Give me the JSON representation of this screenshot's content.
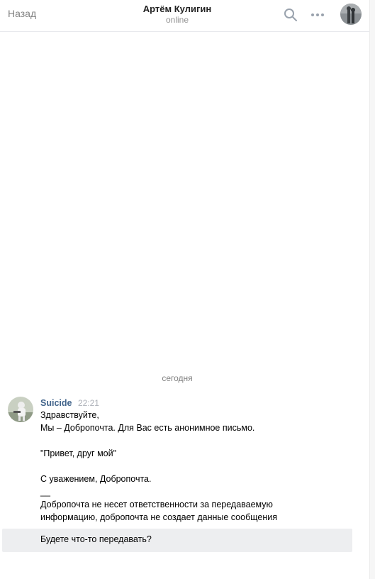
{
  "header": {
    "back_label": "Назад",
    "peer_name": "Артём Кулигин",
    "peer_status": "online",
    "search_icon": "search-icon",
    "more_icon": "more-horizontal-icon"
  },
  "chat": {
    "date_separator": "сегодня",
    "message": {
      "author": "Suicide",
      "time": "22:21",
      "lines": [
        "Здравствуйте,",
        "Мы – Добропочта. Для Вас есть анонимное письмо.",
        "\"Привет, друг мой\"",
        "С уважением, Добропочта.",
        "__",
        "Добропочта не несет ответственности за передаваемую",
        "информацию, добропочта не создает данные сообщения"
      ]
    }
  },
  "composer": {
    "text": "Будете что-то передавать?"
  },
  "colors": {
    "link_blue": "#42648b",
    "muted_gray": "#828282",
    "composer_bg": "#edeef0"
  }
}
